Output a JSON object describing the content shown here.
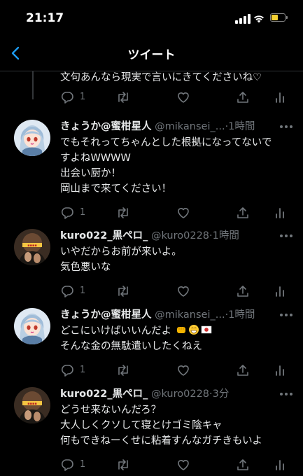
{
  "status": {
    "time": "21:17",
    "battery_color": "#f4d133"
  },
  "nav": {
    "title": "ツイート",
    "back_icon": "chevron-left-icon"
  },
  "top_tweet": {
    "text": "文句あんなら現実で言いにきてくださいね♡",
    "reply_count": "1"
  },
  "tweets": [
    {
      "name": "きょうか@蜜柑星人",
      "handle": "@mikansei_...",
      "time": "1時間",
      "lines": [
        "でもそれってちゃんとした根拠になってないで",
        "すよねWWWW",
        "出会い厨か！",
        "岡山まで来てください！"
      ],
      "reply_count": "1"
    },
    {
      "name": "kuro022_黒ペロ_",
      "handle": "@kuro0228",
      "time": "1時間",
      "lines": [
        "いやだからお前が来いよ。",
        "気色悪いな"
      ],
      "reply_count": "1"
    },
    {
      "name": "きょうか@蜜柑星人",
      "handle": "@mikansei_...",
      "time": "1時間",
      "lines": [
        "どこにいけばいいんだよ",
        "そんな金の無駄遣いしたくねえ"
      ],
      "emojis": [
        "fist-emoji",
        "grin-emoji",
        "japan-flag-emoji"
      ],
      "reply_count": "1"
    },
    {
      "name": "kuro022_黒ペロ_",
      "handle": "@kuro0228",
      "time": "3分",
      "lines": [
        "どうせ来ないんだろ？",
        "大人しくクソして寝とけゴミ陰キャ",
        "何もできねーくせに粘着すんなガチきもいよ"
      ],
      "reply_count": "1"
    }
  ],
  "colors": {
    "muted": "#71767b",
    "text": "#e7e9ea",
    "divider": "#2f3336"
  }
}
